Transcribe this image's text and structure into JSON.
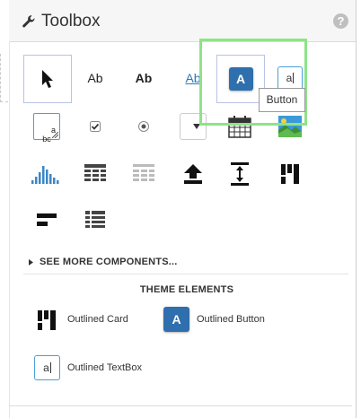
{
  "header": {
    "title": "Toolbox",
    "help_icon": "question-circle-icon",
    "wrench_icon": "wrench-icon"
  },
  "toolbox": {
    "row1": [
      {
        "name": "pointer-tool",
        "icon": "cursor-arrow-icon"
      },
      {
        "name": "label-tool",
        "text": "Ab"
      },
      {
        "name": "bold-label-tool",
        "text": "Ab"
      },
      {
        "name": "link-tool",
        "text": "Ab"
      },
      {
        "name": "button-tool",
        "text": "A"
      },
      {
        "name": "textbox-tool",
        "text": "a"
      }
    ],
    "textarea_text": "a\nbc",
    "tooltip": "Button"
  },
  "see_more": {
    "label": "SEE MORE COMPONENTS..."
  },
  "theme": {
    "heading": "THEME ELEMENTS",
    "items": [
      {
        "label": "Outlined Card",
        "icon": "outlined-card-icon"
      },
      {
        "label": "Outlined Button",
        "icon_text": "A"
      },
      {
        "label": "Outlined TextBox",
        "icon_text": "a"
      }
    ]
  },
  "colors": {
    "accent_blue": "#2f6fae",
    "highlight_green": "#8ee387",
    "selection_border": "#b9c3e6"
  }
}
